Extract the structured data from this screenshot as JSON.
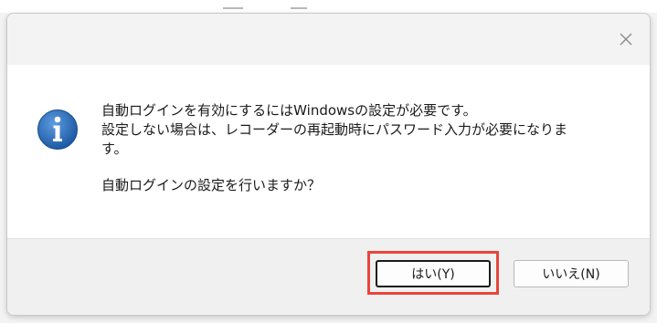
{
  "dialog": {
    "message_lines": [
      "自動ログインを有効にするにはWindowsの設定が必要です。",
      "設定しない場合は、レコーダーの再起動時にパスワード入力が必要になりま",
      "す。"
    ],
    "question": "自動ログインの設定を行いますか？",
    "icon": "info-icon",
    "close_icon": "close-icon"
  },
  "buttons": {
    "yes_label": "はい(Y)",
    "no_label": "いいえ(N)"
  },
  "colors": {
    "highlight": "#e8453c",
    "info_icon": "#2d6cb4"
  }
}
